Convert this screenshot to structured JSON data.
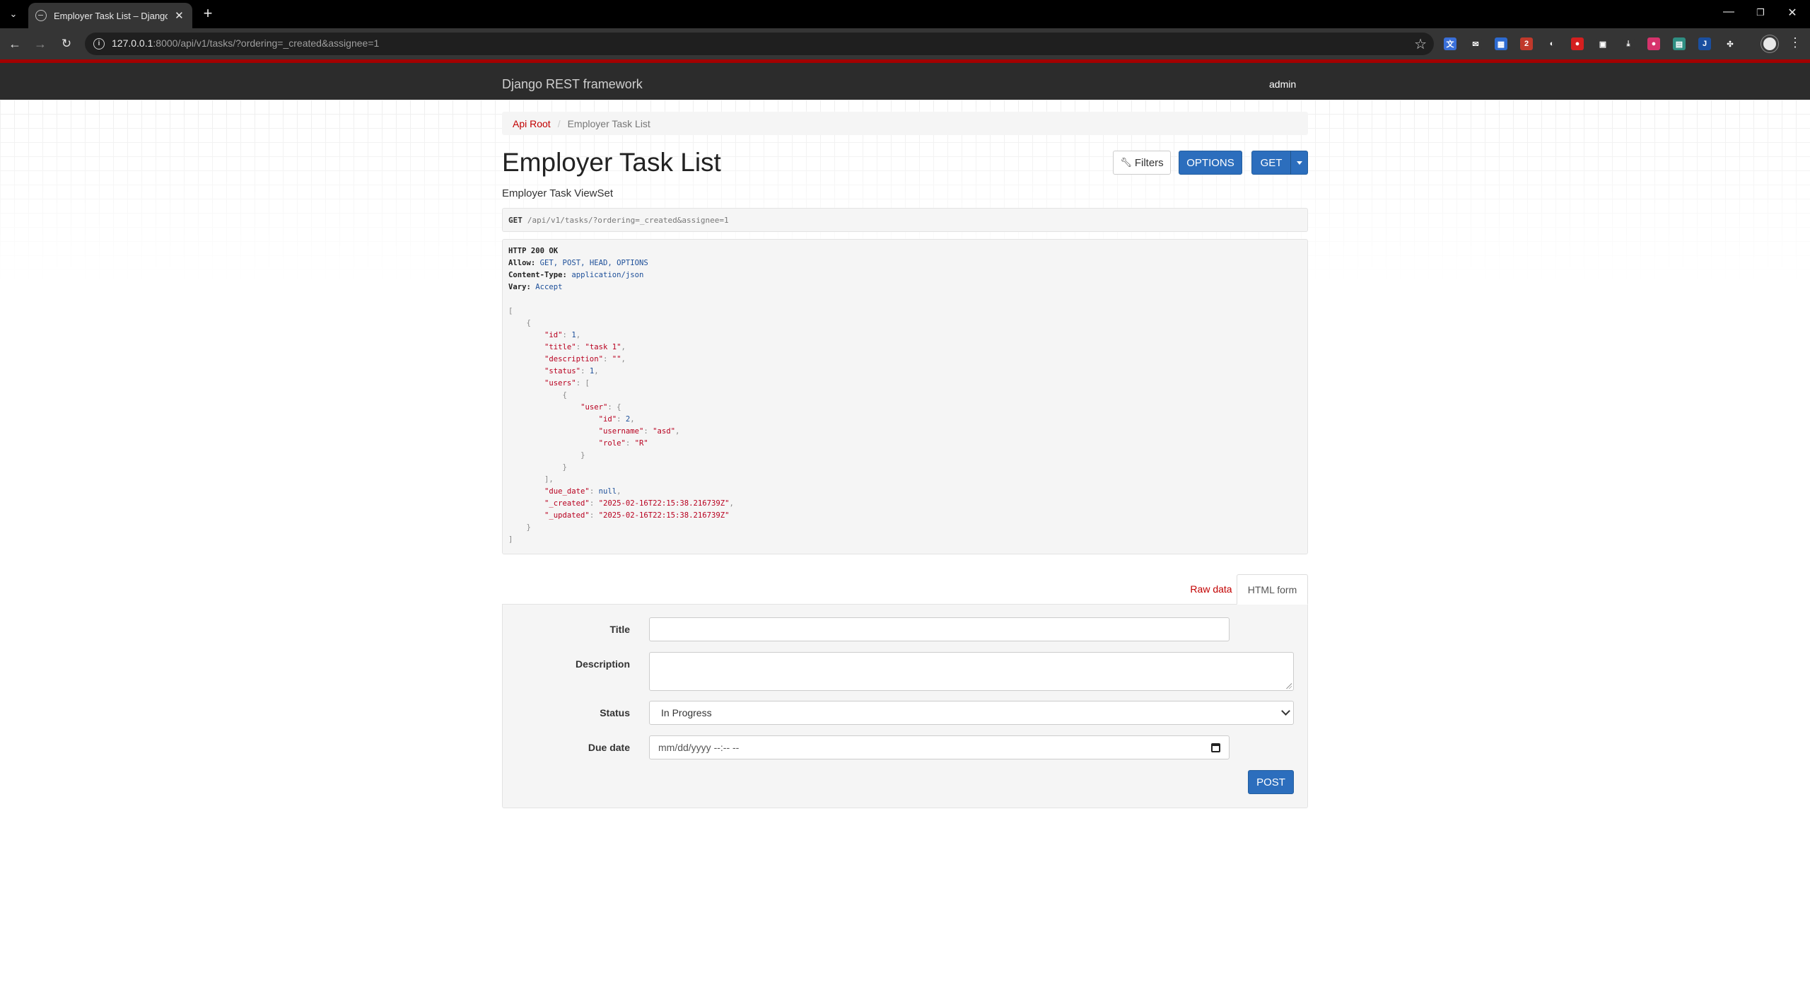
{
  "browser": {
    "tab_title": "Employer Task List – Django REST framework",
    "tab_close": "✕",
    "new_tab": "+",
    "url_host": "127.0.0.1",
    "url_rest": ":8000/api/v1/tasks/?ordering=_created&assignee=1",
    "window_controls": {
      "minimize": "—",
      "restore": "❐",
      "close": "✕"
    },
    "extensions": [
      {
        "name": "translate-extension-icon",
        "color": "#3a6fd8",
        "glyph": "文"
      },
      {
        "name": "mail-extension-icon",
        "color": "#353535",
        "glyph": "✉"
      },
      {
        "name": "calendar-extension-icon",
        "color": "#2d6ad0",
        "glyph": "▦"
      },
      {
        "name": "wappalyzer-extension-icon",
        "color": "#c0392b",
        "glyph": "2"
      },
      {
        "name": "incognito-extension-icon",
        "color": "#353535",
        "glyph": "◐"
      },
      {
        "name": "adblock-extension-icon",
        "color": "#d41f1f",
        "glyph": "●"
      },
      {
        "name": "grid-extension-icon",
        "color": "#353535",
        "glyph": "▣"
      },
      {
        "name": "download-extension-icon",
        "color": "#353535",
        "glyph": "⤓"
      },
      {
        "name": "record-extension-icon",
        "color": "#d6336c",
        "glyph": "●"
      },
      {
        "name": "image-extension-icon",
        "color": "#2f8f83",
        "glyph": "▤"
      },
      {
        "name": "j-extension-icon",
        "color": "#1a4fa0",
        "glyph": "J"
      },
      {
        "name": "puzzle-extension-icon",
        "color": "#353535",
        "glyph": "✣"
      }
    ]
  },
  "navbar": {
    "brand": "Django REST framework",
    "user": "admin"
  },
  "breadcrumb": {
    "root": "Api Root",
    "separator": "/",
    "current": "Employer Task List"
  },
  "page": {
    "title": "Employer Task List",
    "description": "Employer Task ViewSet"
  },
  "buttons": {
    "filters": "Filters",
    "options": "OPTIONS",
    "get": "GET",
    "post": "POST"
  },
  "request": {
    "method": "GET",
    "path": "/api/v1/tasks/?ordering=_created&assignee=1"
  },
  "response": {
    "status": "HTTP 200 OK",
    "headers": [
      {
        "key": "Allow:",
        "value": "GET, POST, HEAD, OPTIONS"
      },
      {
        "key": "Content-Type:",
        "value": "application/json"
      },
      {
        "key": "Vary:",
        "value": "Accept"
      }
    ],
    "body": [
      {
        "id": 1,
        "title": "task 1",
        "description": "",
        "status": 1,
        "users": [
          {
            "user": {
              "id": 2,
              "username": "asd",
              "role": "R"
            }
          }
        ],
        "due_date": null,
        "_created": "2025-02-16T22:15:38.216739Z",
        "_updated": "2025-02-16T22:15:38.216739Z"
      }
    ]
  },
  "tabs": {
    "raw": "Raw data",
    "html": "HTML form"
  },
  "form": {
    "title_label": "Title",
    "title_value": "",
    "description_label": "Description",
    "description_value": "",
    "status_label": "Status",
    "status_value": "In Progress",
    "due_label": "Due date",
    "due_placeholder": "mm/dd/yyyy --:-- --"
  }
}
